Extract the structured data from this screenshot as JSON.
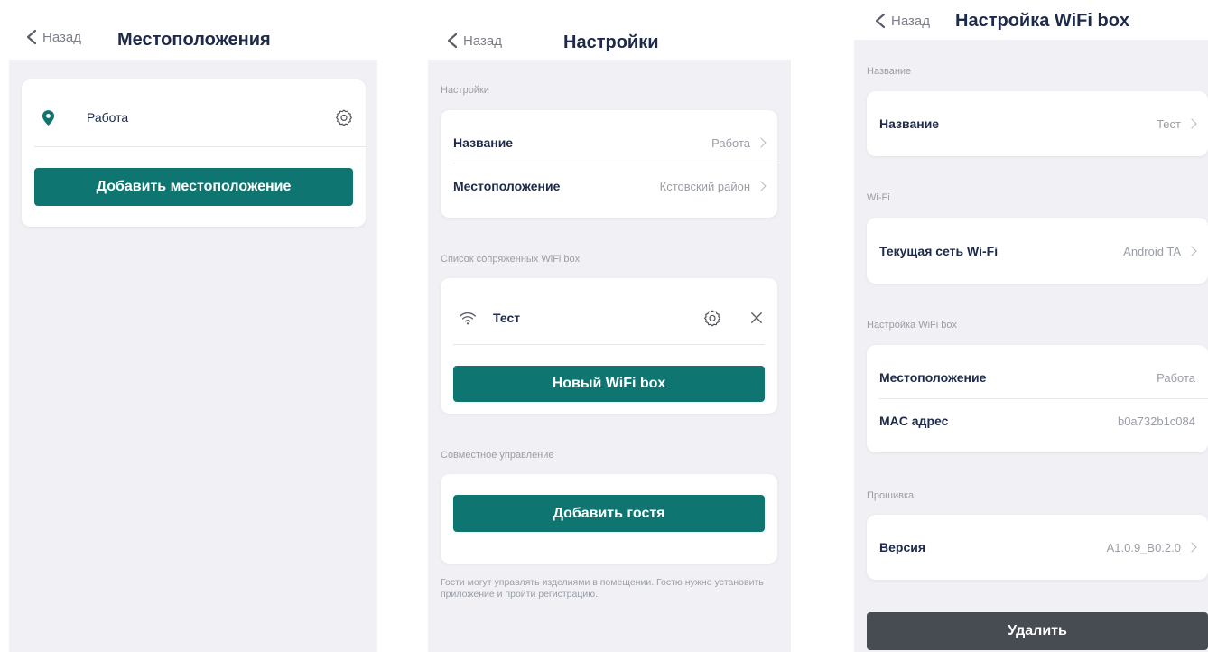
{
  "screens": {
    "locations": {
      "back_label": "Назад",
      "title": "Местоположения",
      "location_name": "Работа",
      "add_location_button": "Добавить местоположение"
    },
    "settings": {
      "back_label": "Назад",
      "title": "Настройки",
      "section_settings": "Настройки",
      "name_label": "Название",
      "name_value": "Работа",
      "location_label": "Местоположение",
      "location_value": "Кстовский район",
      "section_paired": "Список сопряженных WiFi box",
      "wifi_box_name": "Тест",
      "new_wifi_box_button": "Новый WiFi box",
      "section_shared": "Совместное управление",
      "add_guest_button": "Добавить гостя",
      "guest_note": "Гости могут управлять изделиями в помещении. Гостю нужно установить приложение и пройти регистрацию."
    },
    "wifi_box_settings": {
      "back_label": "Назад",
      "title": "Настройка WiFi box",
      "section_name": "Название",
      "name_label": "Название",
      "name_value": "Тест",
      "section_wifi": "Wi-Fi",
      "current_network_label": "Текущая сеть Wi-Fi",
      "current_network_value": "Android TA",
      "section_box": "Настройка WiFi box",
      "location_label": "Местоположение",
      "location_value": "Работа",
      "mac_label": "MAC адрес",
      "mac_value": "b0a732b1c084",
      "section_firmware": "Прошивка",
      "version_label": "Версия",
      "version_value": "A1.0.9_B0.2.0",
      "delete_button": "Удалить"
    }
  },
  "colors": {
    "accent": "#0f7570",
    "title": "#1e2a4a",
    "background": "#f1f1f5",
    "muted": "#9a9ea6",
    "delete_button": "#474b52"
  },
  "icons": [
    "chevron-left-icon",
    "location-pin-icon",
    "gear-icon",
    "wifi-icon",
    "close-icon",
    "chevron-right-icon"
  ]
}
